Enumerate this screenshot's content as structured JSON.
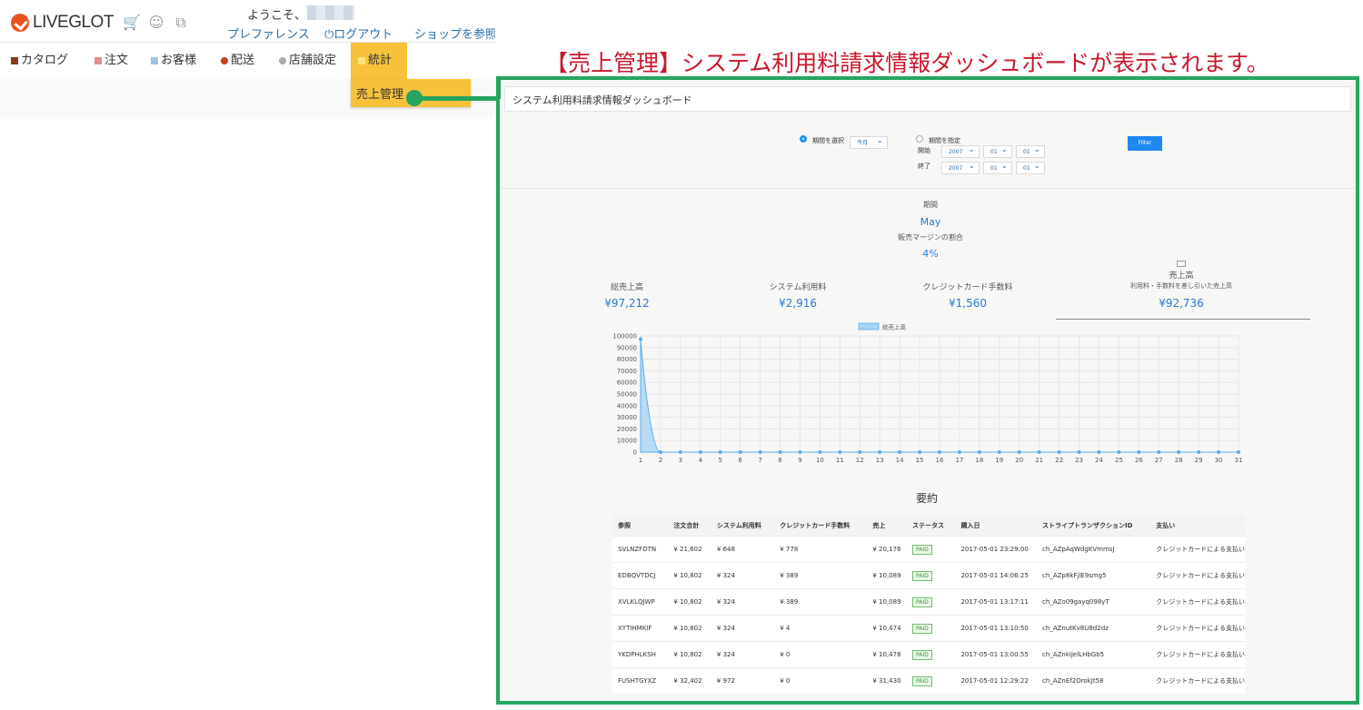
{
  "header": {
    "logo": "LIVEGLOT",
    "welcome": "ようこそ、",
    "links": {
      "preferences": "プレファレンス",
      "logout": "ログアウト",
      "shop": "ショップを参照"
    },
    "icons": [
      "cart-icon",
      "user-icon",
      "windows-icon",
      "power-icon"
    ]
  },
  "nav": {
    "items": [
      {
        "label": "カタログ"
      },
      {
        "label": "注文"
      },
      {
        "label": "お客様"
      },
      {
        "label": "配送"
      },
      {
        "label": "店舗設定"
      },
      {
        "label": "統計"
      }
    ],
    "active": "統計",
    "submenu": "売上管理"
  },
  "caption": "【売上管理】システム利用料請求情報ダッシュボードが表示されます。",
  "dashboard": {
    "title": "システム利用料請求情報ダッシュボード",
    "filter": {
      "select_period": "期間を選択",
      "select_value": "今月",
      "specify_period": "期間を指定",
      "start": "開始",
      "end": "終了",
      "year": "2007",
      "month": "01",
      "day": "01",
      "button": "Filter"
    },
    "period_label": "期間",
    "period_value": "May",
    "margin_label": "販売マージンの割合",
    "margin_value": "4%",
    "stats": [
      {
        "label": "総売上高",
        "value": "¥97,212"
      },
      {
        "label": "システム利用料",
        "value": "¥2,916"
      },
      {
        "label": "クレジットカード手数料",
        "value": "¥1,560"
      },
      {
        "label": "売上高",
        "sublabel": "利用料・手数料を差し引いた売上高",
        "value": "¥92,736"
      }
    ],
    "summary_title": "要約",
    "table": {
      "columns": [
        "参照",
        "注文合計",
        "システム利用料",
        "クレジットカード手数料",
        "売上",
        "ステータス",
        "購入日",
        "ストライプトランザクションID",
        "支払い"
      ],
      "rows": [
        [
          "SVLNZFDTN",
          "¥ 21,602",
          "¥ 648",
          "¥ 778",
          "¥ 20,176",
          "PAID",
          "2017-05-01 23:29:00",
          "ch_AZpAqWdgKVmmsJ",
          "クレジットカードによる支払い"
        ],
        [
          "EDBQVTDCJ",
          "¥ 10,802",
          "¥ 324",
          "¥ 389",
          "¥ 10,089",
          "PAID",
          "2017-05-01 14:06:25",
          "ch_AZp8kFjlE9smg5",
          "クレジットカードによる支払い"
        ],
        [
          "XVLKLQJWP",
          "¥ 10,802",
          "¥ 324",
          "¥ 389",
          "¥ 10,089",
          "PAID",
          "2017-05-01 13:17:11",
          "ch_AZo09gayq098yT",
          "クレジットカードによる支払い"
        ],
        [
          "XYTIHMKIF",
          "¥ 10,802",
          "¥ 324",
          "¥ 4",
          "¥ 10,474",
          "PAID",
          "2017-05-01 13:10:50",
          "ch_AZnutKv8U8d2dz",
          "クレジットカードによる支払い"
        ],
        [
          "YKDPHLKSH",
          "¥ 10,802",
          "¥ 324",
          "¥ 0",
          "¥ 10,478",
          "PAID",
          "2017-05-01 13:00:55",
          "ch_AZnkiJelLHbGb5",
          "クレジットカードによる支払い"
        ],
        [
          "FUSHTGYXZ",
          "¥ 32,402",
          "¥ 972",
          "¥ 0",
          "¥ 31,430",
          "PAID",
          "2017-05-01 12:29:22",
          "ch_AZnEf2OrokJt58",
          "クレジットカードによる支払い"
        ]
      ]
    }
  },
  "chart_data": {
    "type": "area",
    "legend": "総売上高",
    "legend_position": "top-center",
    "x": [
      1,
      2,
      3,
      4,
      5,
      6,
      7,
      8,
      9,
      10,
      11,
      12,
      13,
      14,
      15,
      16,
      17,
      18,
      19,
      20,
      21,
      22,
      23,
      24,
      25,
      26,
      27,
      28,
      29,
      30,
      31
    ],
    "series": [
      {
        "name": "総売上高",
        "values": [
          97212,
          0,
          0,
          0,
          0,
          0,
          0,
          0,
          0,
          0,
          0,
          0,
          0,
          0,
          0,
          0,
          0,
          0,
          0,
          0,
          0,
          0,
          0,
          0,
          0,
          0,
          0,
          0,
          0,
          0,
          0
        ]
      }
    ],
    "ylim": [
      0,
      100000
    ],
    "yticks": [
      0,
      10000,
      20000,
      30000,
      40000,
      50000,
      60000,
      70000,
      80000,
      90000,
      100000
    ],
    "grid": true,
    "colors": {
      "fill": "#a8d4f5",
      "line": "#5aaee8"
    }
  }
}
